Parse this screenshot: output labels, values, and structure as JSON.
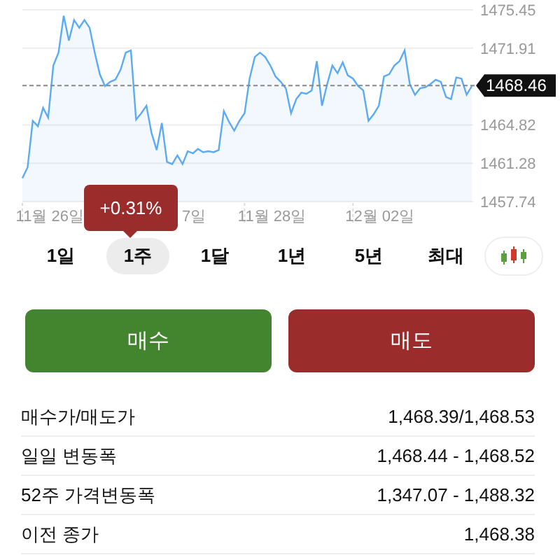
{
  "chart": {
    "chart_data": {
      "type": "area",
      "ylim": [
        1457.74,
        1475.45
      ],
      "yticks": [
        1475.45,
        1471.91,
        1464.82,
        1461.28,
        1457.74
      ],
      "grid": true,
      "ref_lines": [
        {
          "axis": "y",
          "value": 1468.46,
          "label": "1468.46"
        }
      ],
      "series": [
        {
          "color": "#5aaaf5",
          "values": [
            1459.9,
            1460.9,
            1465.2,
            1464.7,
            1466.4,
            1465.5,
            1470.3,
            1471.5,
            1474.9,
            1472.6,
            1474.5,
            1473.8,
            1474.5,
            1473.8,
            1471.5,
            1469.5,
            1468.4,
            1468.8,
            1469.0,
            1469.9,
            1471.5,
            1471.7,
            1465.3,
            1465.9,
            1466.6,
            1464.1,
            1462.5,
            1465.0,
            1461.4,
            1461.2,
            1462.0,
            1461.2,
            1462.4,
            1462.2,
            1462.6,
            1462.3,
            1462.4,
            1462.3,
            1462.5,
            1466.1,
            1465.1,
            1464.3,
            1465.2,
            1465.9,
            1469.1,
            1471.1,
            1471.5,
            1471.1,
            1470.3,
            1469.3,
            1468.8,
            1468.2,
            1465.9,
            1467.2,
            1467.8,
            1467.7,
            1468.0,
            1470.7,
            1466.6,
            1468.6,
            1470.3,
            1469.6,
            1470.6,
            1469.4,
            1469.1,
            1468.4,
            1468.0,
            1465.2,
            1465.8,
            1466.6,
            1469.3,
            1469.5,
            1470.3,
            1470.7,
            1471.7,
            1468.6,
            1467.6,
            1468.2,
            1468.3,
            1468.6,
            1469.0,
            1468.8,
            1467.4,
            1467.2,
            1469.2,
            1469.1,
            1467.6,
            1468.4
          ]
        }
      ]
    },
    "x_labels": [
      "11월 26일",
      "7일",
      "11월 28일",
      "12월 02일"
    ]
  },
  "tooltip": {
    "text": "+0.31%"
  },
  "ranges": [
    {
      "label": "1일",
      "selected": false
    },
    {
      "label": "1주",
      "selected": true
    },
    {
      "label": "1달",
      "selected": false
    },
    {
      "label": "1년",
      "selected": false
    },
    {
      "label": "5년",
      "selected": false
    },
    {
      "label": "최대",
      "selected": false
    }
  ],
  "actions": [
    {
      "label": "매수",
      "kind": "buy"
    },
    {
      "label": "매도",
      "kind": "sell"
    }
  ],
  "stats": [
    {
      "label": "매수가/매도가",
      "value": "1,468.39/1,468.53"
    },
    {
      "label": "일일 변동폭",
      "value": "1,468.44 - 1,468.52"
    },
    {
      "label": "52주 가격변동폭",
      "value": "1,347.07 - 1,488.32"
    },
    {
      "label": "이전 종가",
      "value": "1,468.38"
    }
  ]
}
